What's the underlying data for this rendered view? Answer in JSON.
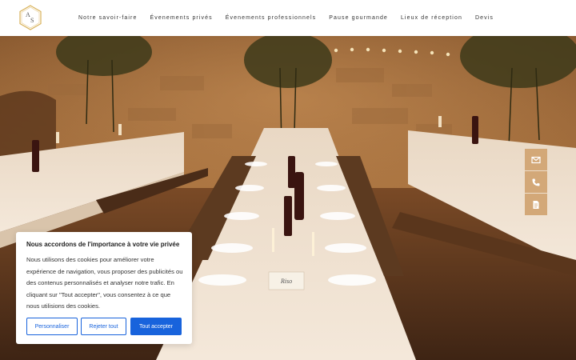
{
  "logo": {
    "letter_a": "A",
    "letter_s": "S"
  },
  "nav": {
    "items": [
      "Notre savoir-faire",
      "Évenements privés",
      "Évenements professionnels",
      "Pause gourmande",
      "Lieux de réception",
      "Devis"
    ]
  },
  "hero": {
    "table_card": "Riso"
  },
  "side_buttons": {
    "icons": [
      "envelope-icon",
      "phone-icon",
      "document-icon"
    ],
    "color": "#d3a878"
  },
  "cookie": {
    "title": "Nous accordons de l'importance à votre vie privée",
    "text": "Nous utilisons des cookies pour améliorer votre expérience de navigation, vous proposer des publicités ou des contenus personnalisés et analyser notre trafic. En cliquant sur \"Tout accepter\", vous consentez à ce que nous utilisions des cookies.",
    "customize_label": "Personnaliser",
    "reject_label": "Rejeter tout",
    "accept_label": "Tout accepter",
    "accent_color": "#1863dc"
  }
}
